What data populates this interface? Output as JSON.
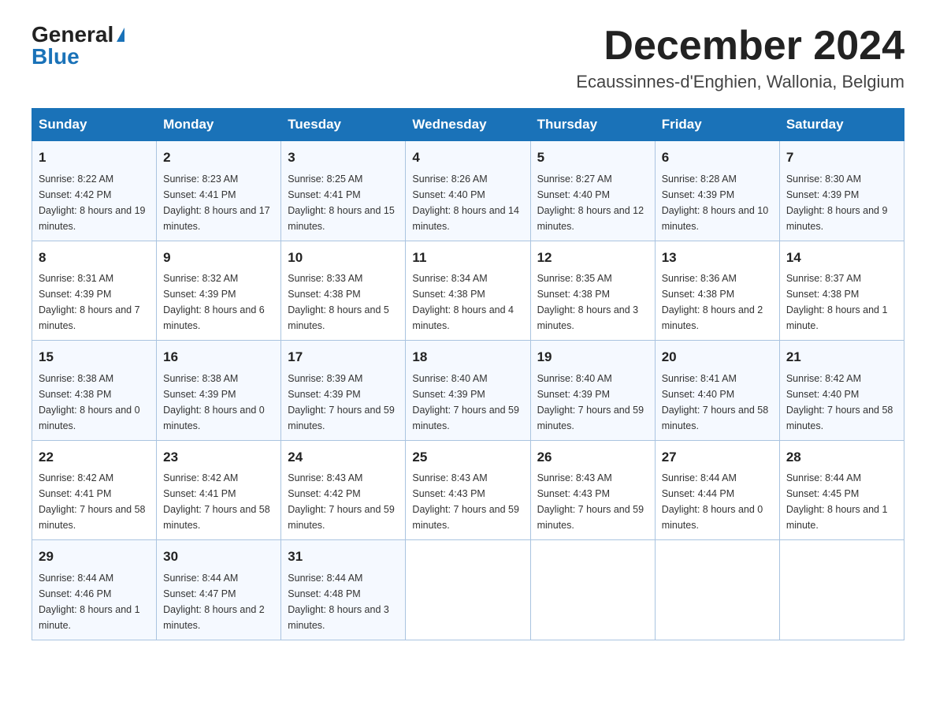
{
  "logo": {
    "general": "General",
    "blue": "Blue"
  },
  "title": {
    "month": "December 2024",
    "location": "Ecaussinnes-d'Enghien, Wallonia, Belgium"
  },
  "days_of_week": [
    "Sunday",
    "Monday",
    "Tuesday",
    "Wednesday",
    "Thursday",
    "Friday",
    "Saturday"
  ],
  "weeks": [
    [
      {
        "day": "1",
        "sunrise": "8:22 AM",
        "sunset": "4:42 PM",
        "daylight": "8 hours and 19 minutes."
      },
      {
        "day": "2",
        "sunrise": "8:23 AM",
        "sunset": "4:41 PM",
        "daylight": "8 hours and 17 minutes."
      },
      {
        "day": "3",
        "sunrise": "8:25 AM",
        "sunset": "4:41 PM",
        "daylight": "8 hours and 15 minutes."
      },
      {
        "day": "4",
        "sunrise": "8:26 AM",
        "sunset": "4:40 PM",
        "daylight": "8 hours and 14 minutes."
      },
      {
        "day": "5",
        "sunrise": "8:27 AM",
        "sunset": "4:40 PM",
        "daylight": "8 hours and 12 minutes."
      },
      {
        "day": "6",
        "sunrise": "8:28 AM",
        "sunset": "4:39 PM",
        "daylight": "8 hours and 10 minutes."
      },
      {
        "day": "7",
        "sunrise": "8:30 AM",
        "sunset": "4:39 PM",
        "daylight": "8 hours and 9 minutes."
      }
    ],
    [
      {
        "day": "8",
        "sunrise": "8:31 AM",
        "sunset": "4:39 PM",
        "daylight": "8 hours and 7 minutes."
      },
      {
        "day": "9",
        "sunrise": "8:32 AM",
        "sunset": "4:39 PM",
        "daylight": "8 hours and 6 minutes."
      },
      {
        "day": "10",
        "sunrise": "8:33 AM",
        "sunset": "4:38 PM",
        "daylight": "8 hours and 5 minutes."
      },
      {
        "day": "11",
        "sunrise": "8:34 AM",
        "sunset": "4:38 PM",
        "daylight": "8 hours and 4 minutes."
      },
      {
        "day": "12",
        "sunrise": "8:35 AM",
        "sunset": "4:38 PM",
        "daylight": "8 hours and 3 minutes."
      },
      {
        "day": "13",
        "sunrise": "8:36 AM",
        "sunset": "4:38 PM",
        "daylight": "8 hours and 2 minutes."
      },
      {
        "day": "14",
        "sunrise": "8:37 AM",
        "sunset": "4:38 PM",
        "daylight": "8 hours and 1 minute."
      }
    ],
    [
      {
        "day": "15",
        "sunrise": "8:38 AM",
        "sunset": "4:38 PM",
        "daylight": "8 hours and 0 minutes."
      },
      {
        "day": "16",
        "sunrise": "8:38 AM",
        "sunset": "4:39 PM",
        "daylight": "8 hours and 0 minutes."
      },
      {
        "day": "17",
        "sunrise": "8:39 AM",
        "sunset": "4:39 PM",
        "daylight": "7 hours and 59 minutes."
      },
      {
        "day": "18",
        "sunrise": "8:40 AM",
        "sunset": "4:39 PM",
        "daylight": "7 hours and 59 minutes."
      },
      {
        "day": "19",
        "sunrise": "8:40 AM",
        "sunset": "4:39 PM",
        "daylight": "7 hours and 59 minutes."
      },
      {
        "day": "20",
        "sunrise": "8:41 AM",
        "sunset": "4:40 PM",
        "daylight": "7 hours and 58 minutes."
      },
      {
        "day": "21",
        "sunrise": "8:42 AM",
        "sunset": "4:40 PM",
        "daylight": "7 hours and 58 minutes."
      }
    ],
    [
      {
        "day": "22",
        "sunrise": "8:42 AM",
        "sunset": "4:41 PM",
        "daylight": "7 hours and 58 minutes."
      },
      {
        "day": "23",
        "sunrise": "8:42 AM",
        "sunset": "4:41 PM",
        "daylight": "7 hours and 58 minutes."
      },
      {
        "day": "24",
        "sunrise": "8:43 AM",
        "sunset": "4:42 PM",
        "daylight": "7 hours and 59 minutes."
      },
      {
        "day": "25",
        "sunrise": "8:43 AM",
        "sunset": "4:43 PM",
        "daylight": "7 hours and 59 minutes."
      },
      {
        "day": "26",
        "sunrise": "8:43 AM",
        "sunset": "4:43 PM",
        "daylight": "7 hours and 59 minutes."
      },
      {
        "day": "27",
        "sunrise": "8:44 AM",
        "sunset": "4:44 PM",
        "daylight": "8 hours and 0 minutes."
      },
      {
        "day": "28",
        "sunrise": "8:44 AM",
        "sunset": "4:45 PM",
        "daylight": "8 hours and 1 minute."
      }
    ],
    [
      {
        "day": "29",
        "sunrise": "8:44 AM",
        "sunset": "4:46 PM",
        "daylight": "8 hours and 1 minute."
      },
      {
        "day": "30",
        "sunrise": "8:44 AM",
        "sunset": "4:47 PM",
        "daylight": "8 hours and 2 minutes."
      },
      {
        "day": "31",
        "sunrise": "8:44 AM",
        "sunset": "4:48 PM",
        "daylight": "8 hours and 3 minutes."
      },
      null,
      null,
      null,
      null
    ]
  ],
  "labels": {
    "sunrise": "Sunrise:",
    "sunset": "Sunset:",
    "daylight": "Daylight:"
  }
}
